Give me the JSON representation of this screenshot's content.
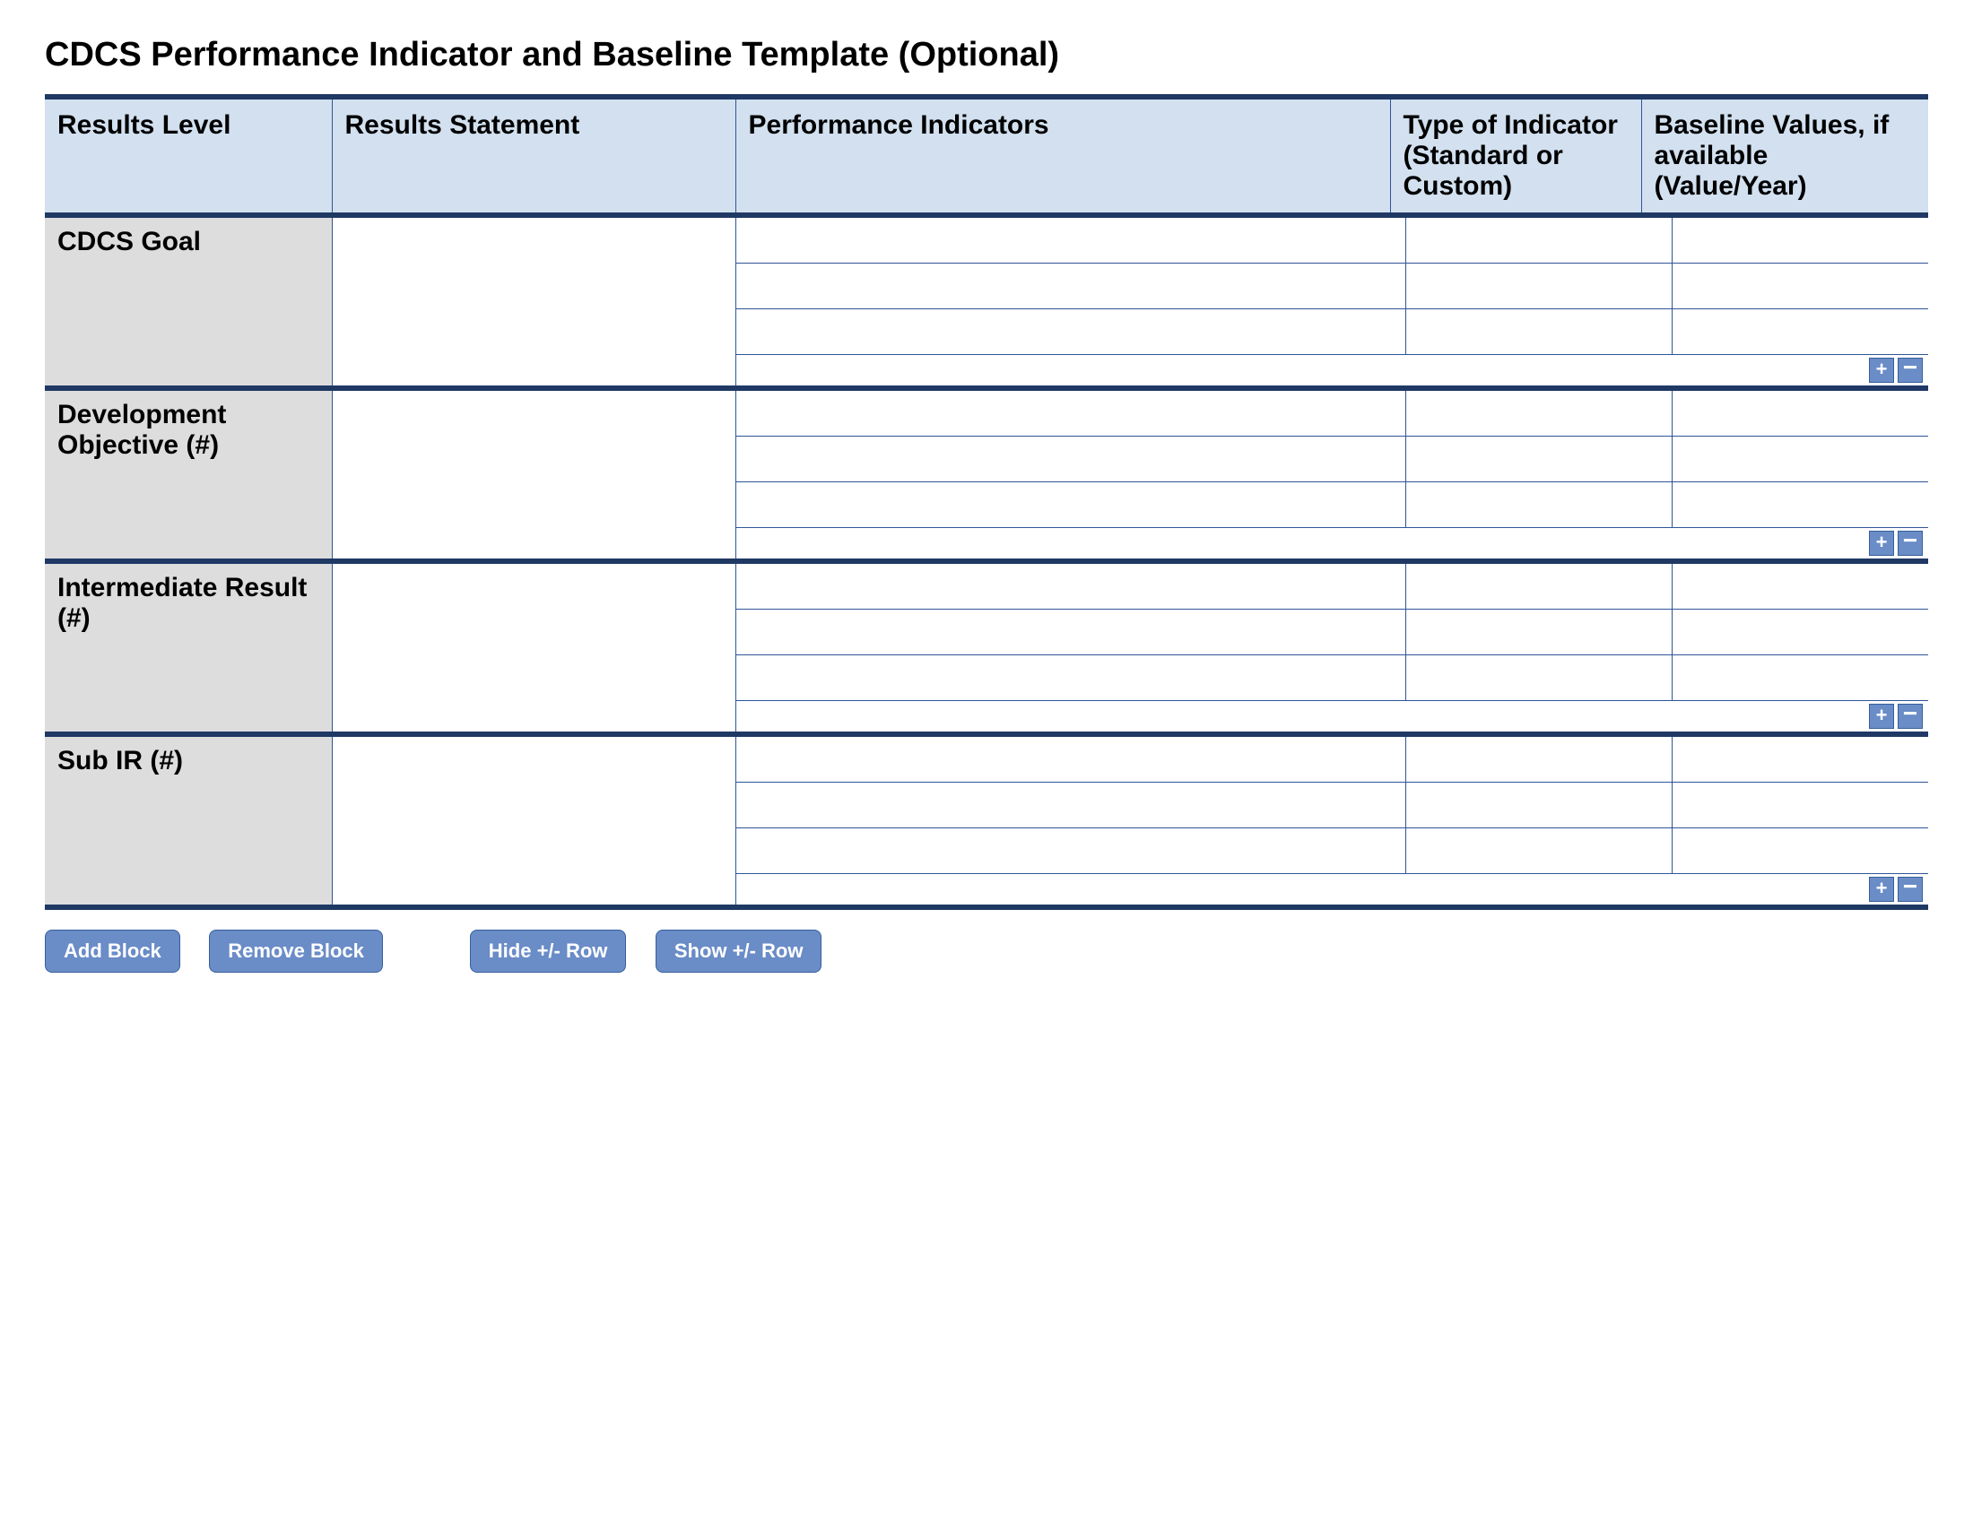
{
  "title": "CDCS Performance Indicator and Baseline Template (Optional)",
  "headers": {
    "results_level": "Results Level",
    "results_statement": "Results Statement",
    "performance_indicators": "Performance Indicators",
    "type_of_indicator": "Type of Indicator (Standard or Custom)",
    "baseline_values": "Baseline Values, if available (Value/Year)"
  },
  "sections": [
    {
      "label": "CDCS Goal",
      "statement": "",
      "rows": [
        {
          "indicator": "",
          "type": "",
          "baseline": ""
        },
        {
          "indicator": "",
          "type": "",
          "baseline": ""
        },
        {
          "indicator": "",
          "type": "",
          "baseline": ""
        }
      ],
      "plus": "+",
      "minus": "−"
    },
    {
      "label": "Development Objective (#)",
      "statement": "",
      "rows": [
        {
          "indicator": "",
          "type": "",
          "baseline": ""
        },
        {
          "indicator": "",
          "type": "",
          "baseline": ""
        },
        {
          "indicator": "",
          "type": "",
          "baseline": ""
        }
      ],
      "plus": "+",
      "minus": "−"
    },
    {
      "label": "Intermediate Result (#)",
      "statement": "",
      "rows": [
        {
          "indicator": "",
          "type": "",
          "baseline": ""
        },
        {
          "indicator": "",
          "type": "",
          "baseline": ""
        },
        {
          "indicator": "",
          "type": "",
          "baseline": ""
        }
      ],
      "plus": "+",
      "minus": "−"
    },
    {
      "label": "Sub IR (#)",
      "statement": "",
      "rows": [
        {
          "indicator": "",
          "type": "",
          "baseline": ""
        },
        {
          "indicator": "",
          "type": "",
          "baseline": ""
        },
        {
          "indicator": "",
          "type": "",
          "baseline": ""
        }
      ],
      "plus": "+",
      "minus": "−"
    }
  ],
  "buttons": {
    "add_block": "Add Block",
    "remove_block": "Remove Block",
    "hide_row": "Hide +/- Row",
    "show_row": "Show +/- Row"
  }
}
